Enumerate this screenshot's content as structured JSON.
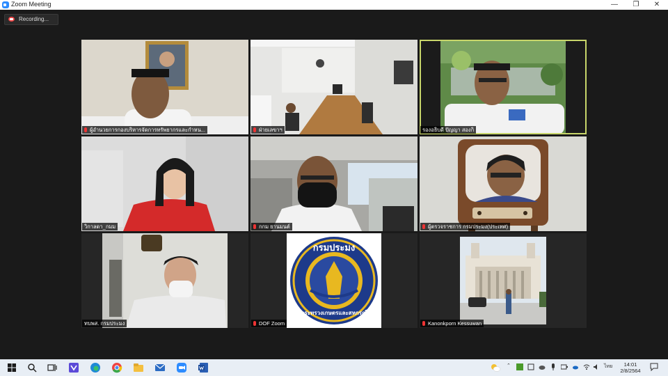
{
  "window": {
    "title": "Zoom Meeting",
    "controls": [
      "—",
      "❐",
      "✕"
    ]
  },
  "recording": {
    "label": "Recording..."
  },
  "participants": [
    {
      "name": "ผู้อำนวยการกองบริหารจัดการทรัพยากรและกำหน...",
      "muted": true
    },
    {
      "name": "ฝ่ายเลขาฯ",
      "muted": true
    },
    {
      "name": "รองอธิบดี ปัญญา สองกิ",
      "muted": false,
      "active": true
    },
    {
      "name": "วิกาลดา_กมม",
      "muted": false
    },
    {
      "name": "กกม ยานมนต์",
      "muted": true
    },
    {
      "name": "ผู้ตรวจราชการ กรมประมง(ประเทศ)",
      "muted": true
    },
    {
      "name": "ทบพส. กรมประมง",
      "muted": false
    },
    {
      "name": "DOF Zoom",
      "muted": true
    },
    {
      "name": "Kanonkporn Kessuwan",
      "muted": true
    }
  ],
  "logo": {
    "top_text": "กรมประมง",
    "bottom_text": "กระทรวงเกษตรและสหกรณ์"
  },
  "taskbar": {
    "apps": [
      "windows-start",
      "search",
      "task-view",
      "visual-studio",
      "edge",
      "chrome",
      "file-explorer",
      "mail",
      "zoom",
      "word"
    ],
    "tray_lang": "ไทย",
    "time": "14:01",
    "date": "2/8/2564"
  }
}
